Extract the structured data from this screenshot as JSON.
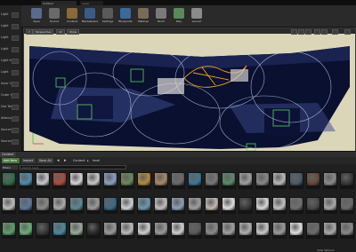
{
  "window": {
    "title_tab": "Untitled",
    "tab2": "Level"
  },
  "left_panel": {
    "rows": [
      "Light",
      "Light",
      "Light",
      "Light",
      "Light Inten",
      "Light",
      "Inner Cone",
      "Outer Cone",
      "Use Temp",
      "Attenuation",
      "Source Rad",
      "Source Len"
    ]
  },
  "toolbar": {
    "buttons": [
      {
        "label": "Save",
        "icon": "save-icon",
        "color": "#5a6a8a"
      },
      {
        "label": "Source",
        "icon": "source-control-icon",
        "color": "#6a6a6a"
      },
      {
        "label": "Content",
        "icon": "content-icon",
        "color": "#8a6a3a"
      },
      {
        "label": "Marketplace",
        "icon": "marketplace-icon",
        "color": "#3a5a8a"
      },
      {
        "label": "Settings",
        "icon": "settings-icon",
        "color": "#5a5a5a"
      },
      {
        "label": "Blueprints",
        "icon": "blueprint-icon",
        "color": "#3a6a9a"
      },
      {
        "label": "Matinee",
        "icon": "matinee-icon",
        "color": "#7a6a5a"
      },
      {
        "label": "Build",
        "icon": "build-icon",
        "color": "#7a7a7a"
      },
      {
        "label": "Play",
        "icon": "play-icon",
        "color": "#5a8a5a"
      },
      {
        "label": "Launch",
        "icon": "launch-icon",
        "color": "#8a8a8a"
      }
    ]
  },
  "viewport": {
    "view_mode": "Perspective",
    "lit_mode": "Lit",
    "show": "Show",
    "level_label": "Level: ToDoLevel (Persistent)"
  },
  "content_browser": {
    "tab_label": "Content Browser",
    "add_new": "Add New",
    "import": "Import",
    "save_all": "Save All",
    "breadcrumb": [
      "Content",
      "level"
    ],
    "filters": "Filters",
    "search_placeholder": "Search level",
    "status": "View Options"
  },
  "assets": {
    "row1": [
      "#2d6e4a",
      "#4d8ea8",
      "#c9c9c9",
      "#b04a3a",
      "#d4d4d4",
      "#c8c8c8",
      "#8aa0c8",
      "#6a8a5a",
      "#b48a3a",
      "#aa8866",
      "#6a6a6a",
      "#3a7a9a",
      "#777777",
      "#5a8a6a",
      "#a0a0a0",
      "#888888",
      "#b8b8b8",
      "#4a5a6a",
      "#6a4a3a",
      "#8a8a8a",
      "#3a3a3a"
    ],
    "row2": [
      "#bdbdbd",
      "#5a7aa0",
      "#8a8a8a",
      "#aaaaaa",
      "#5a8a9a",
      "#9a9a9a",
      "#3a6a8a",
      "#d0d0d0",
      "#6a9ab0",
      "#c0c0c0",
      "#8aa0b8",
      "#a0a0a0",
      "#c0b8b0",
      "#e0e0e0",
      "#3a3a3a",
      "#d8d8d8",
      "#c0c0c0",
      "#707070",
      "#4a4a4a",
      "#a8a8a8",
      "#6a6a6a"
    ],
    "row3": [
      "#5aa06a",
      "#6ab07a",
      "#3a3a3a",
      "#4a8aa0",
      "#9aaa9a",
      "#2a2a2a",
      "#9a9a9a",
      "#bcbcbc",
      "#cfcfcf",
      "#9a9a9a",
      "#d0d0d0",
      "#5a5a5a",
      "#8a8a8a",
      "#a0a0a0",
      "#b0b0b0",
      "#c8c8c8",
      "#9a9a9a",
      "#e0e0e0",
      "#6a6a6a",
      "#aaaaaa",
      "#888888"
    ]
  }
}
